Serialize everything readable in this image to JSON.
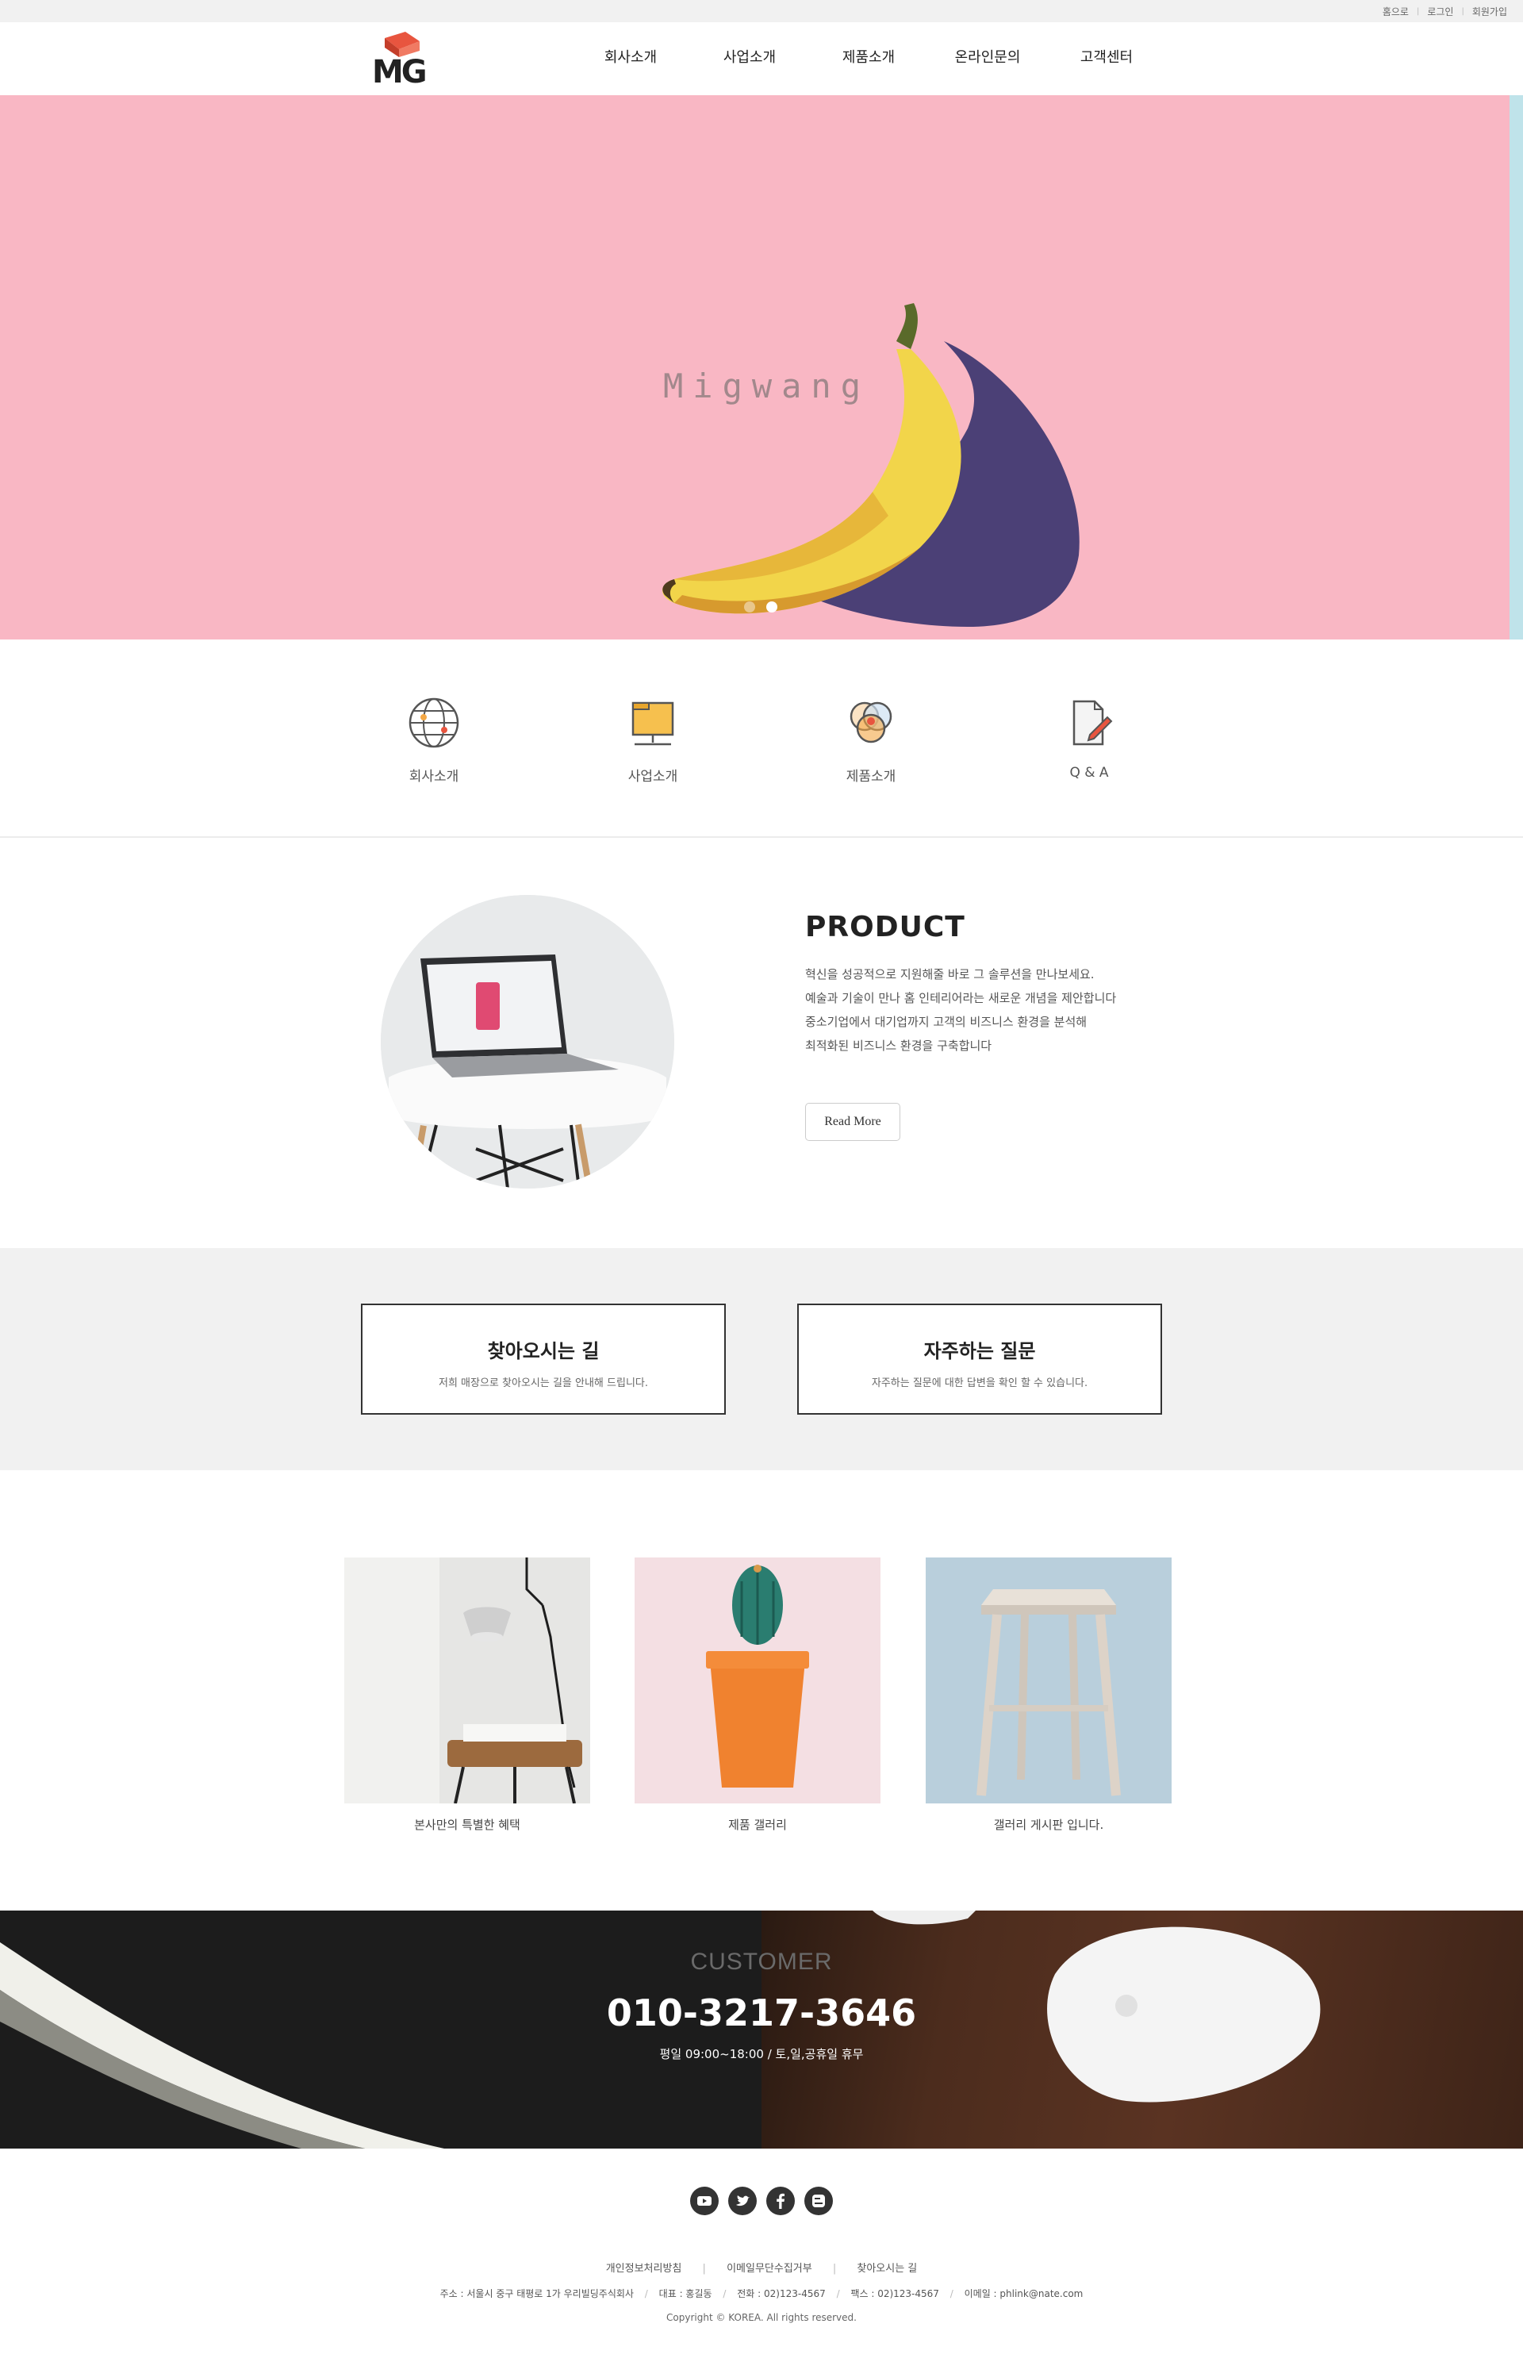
{
  "topbar": {
    "links": [
      "홈으로",
      "로그인",
      "회원가입"
    ]
  },
  "header": {
    "logo_text": "MG",
    "logo_badge": "Migwang",
    "nav": [
      "회사소개",
      "사업소개",
      "제품소개",
      "온라인문의",
      "고객센터"
    ]
  },
  "hero": {
    "brand_text": "Migwang",
    "slides_total": 2,
    "active_slide": 2,
    "colors": {
      "background": "#f9b7c4",
      "shadow": "#4b4076",
      "banana": "#f2d54a"
    }
  },
  "quick_menu": [
    {
      "label": "회사소개",
      "icon": "globe-icon"
    },
    {
      "label": "사업소개",
      "icon": "folder-network-icon"
    },
    {
      "label": "제품소개",
      "icon": "venn-circles-icon"
    },
    {
      "label": "Q & A",
      "icon": "document-pen-icon"
    }
  ],
  "product": {
    "title": "PRODUCT",
    "lines": [
      "혁신을 성공적으로 지원해줄 바로 그 솔루션을 만나보세요.",
      "예술과 기술이 만나 홈 인테리어라는 새로운 개념을 제안합니다",
      "중소기업에서 대기업까지 고객의 비즈니스 환경을 분석해",
      "최적화된 비즈니스 환경을 구축합니다"
    ],
    "button": "Read More"
  },
  "info_boxes": [
    {
      "title": "찾아오시는 길",
      "text": "저희 매장으로 찾아오시는 길을 안내해 드립니다."
    },
    {
      "title": "자주하는 질문",
      "text": "자주하는 질문에 대한 답변을 확인 할 수 있습니다."
    }
  ],
  "gallery": [
    {
      "caption": "본사만의 특별한 혜택"
    },
    {
      "caption": "제품 갤러리"
    },
    {
      "caption": "갤러리 게시판 입니다."
    }
  ],
  "customer": {
    "label": "CUSTOMER",
    "phone": "010-3217-3646",
    "hours": "평일 09:00~18:00 / 토,일,공휴일 휴무"
  },
  "footer": {
    "sns": [
      "youtube-icon",
      "twitter-icon",
      "facebook-icon",
      "blogger-icon"
    ],
    "links": [
      "개인정보처리방침",
      "이메일무단수집거부",
      "찾아오시는 길"
    ],
    "address": [
      "주소 : 서울시 중구 태평로 1가 우리빌딩주식회사",
      "대표 : 홍길동",
      "전화 : 02)123-4567",
      "팩스 : 02)123-4567",
      "이메일 : phlink@nate.com"
    ],
    "copyright": "Copyright © KOREA. All rights reserved."
  }
}
